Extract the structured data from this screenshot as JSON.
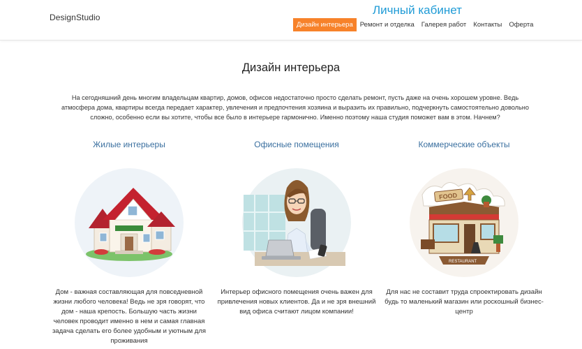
{
  "header": {
    "logo": "DesignStudio",
    "cabinet_link": "Личный кабинет",
    "nav": [
      {
        "label": "Дизайн интерьера",
        "active": true
      },
      {
        "label": "Ремонт и отделка",
        "active": false
      },
      {
        "label": "Галерея работ",
        "active": false
      },
      {
        "label": "Контакты",
        "active": false
      },
      {
        "label": "Оферта",
        "active": false
      }
    ]
  },
  "main": {
    "title": "Дизайн интерьера",
    "intro": "На сегодняшний день многим владельцам квартир, домов, офисов недостаточно просто сделать ремонт, пусть даже на очень хорошем уровне. Ведь атмосфера дома, квартиры всегда передает характер, увлечения и предпочтения хозяина и выразить их правильно, подчеркнуть самостоятельно довольно сложно, особенно если вы хотите, чтобы все было в интерьере гармонично. Именно поэтому наша студия поможет вам в этом. Начнем?",
    "columns": [
      {
        "title": "Жилые интерьеры",
        "icon": "house-illustration",
        "text": "Дом - важная составляющая для повседневной жизни любого человека! Ведь не зря говорят, что дом - наша крепость. Большую часть жизни человек проводит именно в нем и самая главная задача сделать его более удобным и уютным для проживания"
      },
      {
        "title": "Офисные помещения",
        "icon": "office-woman-illustration",
        "text": "Интерьер офисного помещения очень важен для привлечения новых клиентов. Да и не зря внешний вид офиса считают лицом компании!"
      },
      {
        "title": "Коммерческие объекты",
        "icon": "restaurant-illustration",
        "text": "Для нас не составит труда спроектировать дизайн будь то маленький магазин или роскошный бизнес-центр",
        "sign_food": "FOOD",
        "sign_restaurant": "RESTAURANT"
      }
    ]
  },
  "colors": {
    "accent": "#f7822a",
    "cabinet": "#1f9bd6",
    "column_title": "#3a6f9f"
  }
}
